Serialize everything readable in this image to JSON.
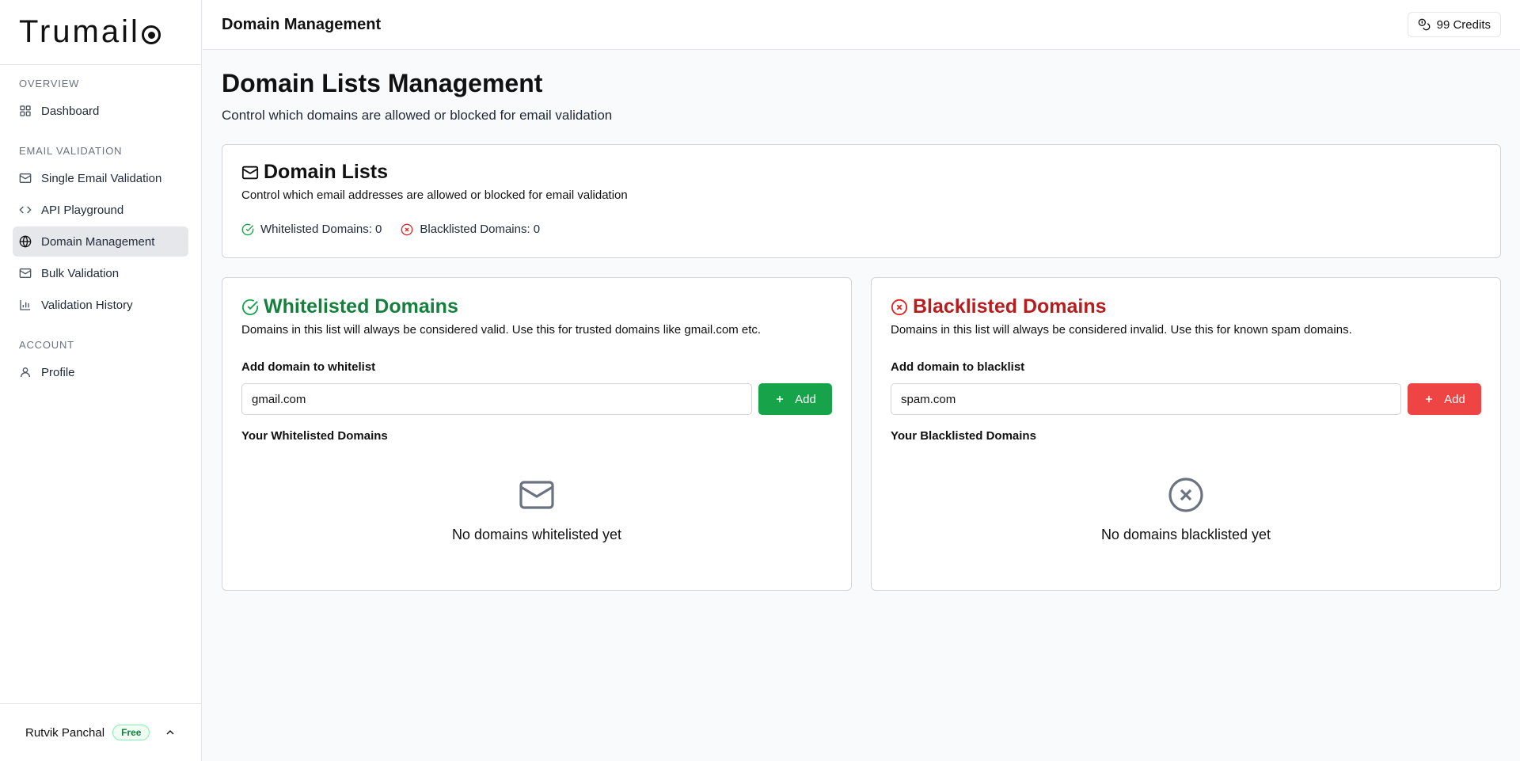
{
  "app": {
    "logo_text": "Trumail"
  },
  "sidebar": {
    "sections": [
      {
        "heading": "OVERVIEW",
        "items": [
          {
            "label": "Dashboard",
            "icon": "grid-icon"
          }
        ]
      },
      {
        "heading": "EMAIL VALIDATION",
        "items": [
          {
            "label": "Single Email Validation",
            "icon": "mail-icon"
          },
          {
            "label": "API Playground",
            "icon": "code-icon"
          },
          {
            "label": "Domain Management",
            "icon": "globe-icon",
            "active": true
          },
          {
            "label": "Bulk Validation",
            "icon": "mail-icon"
          },
          {
            "label": "Validation History",
            "icon": "bar-chart-icon"
          }
        ]
      },
      {
        "heading": "ACCOUNT",
        "items": [
          {
            "label": "Profile",
            "icon": "user-icon"
          }
        ]
      }
    ],
    "footer": {
      "user_name": "Rutvik Panchal",
      "plan": "Free"
    }
  },
  "topbar": {
    "title": "Domain Management",
    "credits": "99 Credits"
  },
  "page": {
    "title": "Domain Lists Management",
    "subtitle": "Control which domains are allowed or blocked for email validation"
  },
  "summary": {
    "title": "Domain Lists",
    "description": "Control which email addresses are allowed or blocked for email validation",
    "whitelisted_count": "Whitelisted Domains: 0",
    "blacklisted_count": "Blacklisted Domains: 0"
  },
  "whitelist": {
    "title": "Whitelisted Domains",
    "description": "Domains in this list will always be considered valid. Use this for trusted domains like gmail.com etc.",
    "field_label": "Add domain to whitelist",
    "placeholder": "gmail.com",
    "button": "Add",
    "list_label": "Your Whitelisted Domains",
    "empty_text": "No domains whitelisted yet",
    "color": "#15803d"
  },
  "blacklist": {
    "title": "Blacklisted Domains",
    "description": "Domains in this list will always be considered invalid. Use this for known spam domains.",
    "field_label": "Add domain to blacklist",
    "placeholder": "spam.com",
    "button": "Add",
    "list_label": "Your Blacklisted Domains",
    "empty_text": "No domains blacklisted yet",
    "color": "#b91c1c"
  }
}
